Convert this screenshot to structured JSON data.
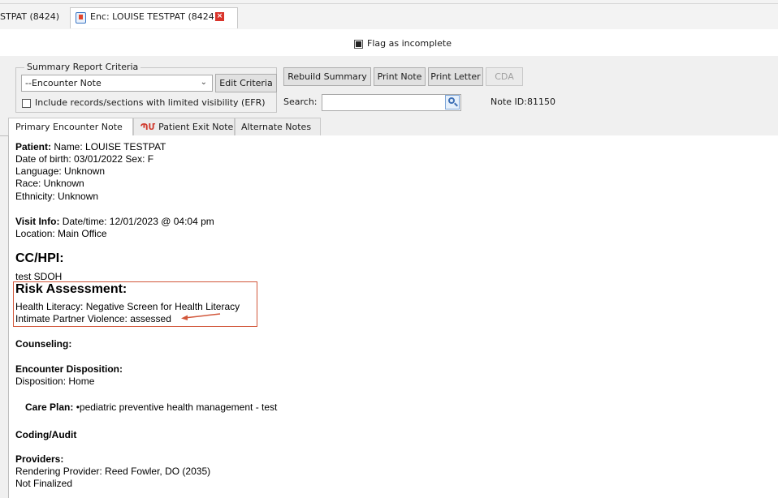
{
  "tabs": {
    "first": "STPAT (8424)",
    "active": "Enc: LOUISE TESTPAT (8424)"
  },
  "flag": {
    "label": "Flag as incomplete"
  },
  "criteria": {
    "legend": "Summary Report Criteria",
    "selected_report": "--Encounter Note",
    "edit_button": "Edit Criteria",
    "efr_label": "Include records/sections with limited visibility (EFR)",
    "rebuild_button": "Rebuild Summary",
    "print_note_button": "Print Note",
    "print_letter_button": "Print Letter",
    "cda_button": "CDA",
    "search_label": "Search:",
    "search_value": "",
    "note_id": "Note ID:81150"
  },
  "note_tabs": [
    "Primary Encounter Note",
    "Patient Exit Note",
    "Alternate Notes"
  ],
  "note": {
    "patient_label": "Patient:",
    "patient_name": " Name: LOUISE TESTPAT",
    "dob_sex": "Date of birth: 03/01/2022   Sex: F",
    "language": "Language: Unknown",
    "race": "Race: Unknown",
    "ethnicity": "Ethnicity: Unknown",
    "visit_label": "Visit Info:",
    "visit_datetime": " Date/time: 12/01/2023 @ 04:04 pm",
    "location": "Location: Main Office",
    "cchpi_heading": "CC/HPI:",
    "cchpi_text": "test SDOH",
    "risk_heading": "Risk Assessment:",
    "health_literacy": "Health Literacy: Negative Screen for Health Literacy",
    "ipv": "Intimate Partner Violence: assessed",
    "counseling_heading": "Counseling:",
    "disposition_heading": "Encounter Disposition:",
    "disposition": "Disposition: Home",
    "care_plan_label": "Care Plan:",
    "care_plan_text": " •pediatric preventive health management - test",
    "coding_heading": "Coding/Audit",
    "providers_heading": "Providers:",
    "rendering_provider": "Rendering Provider: Reed Fowler, DO (2035)",
    "finalized": "Not Finalized"
  },
  "colors": {
    "highlight_box": "#d2573b",
    "close_icon": "#d9342b"
  }
}
